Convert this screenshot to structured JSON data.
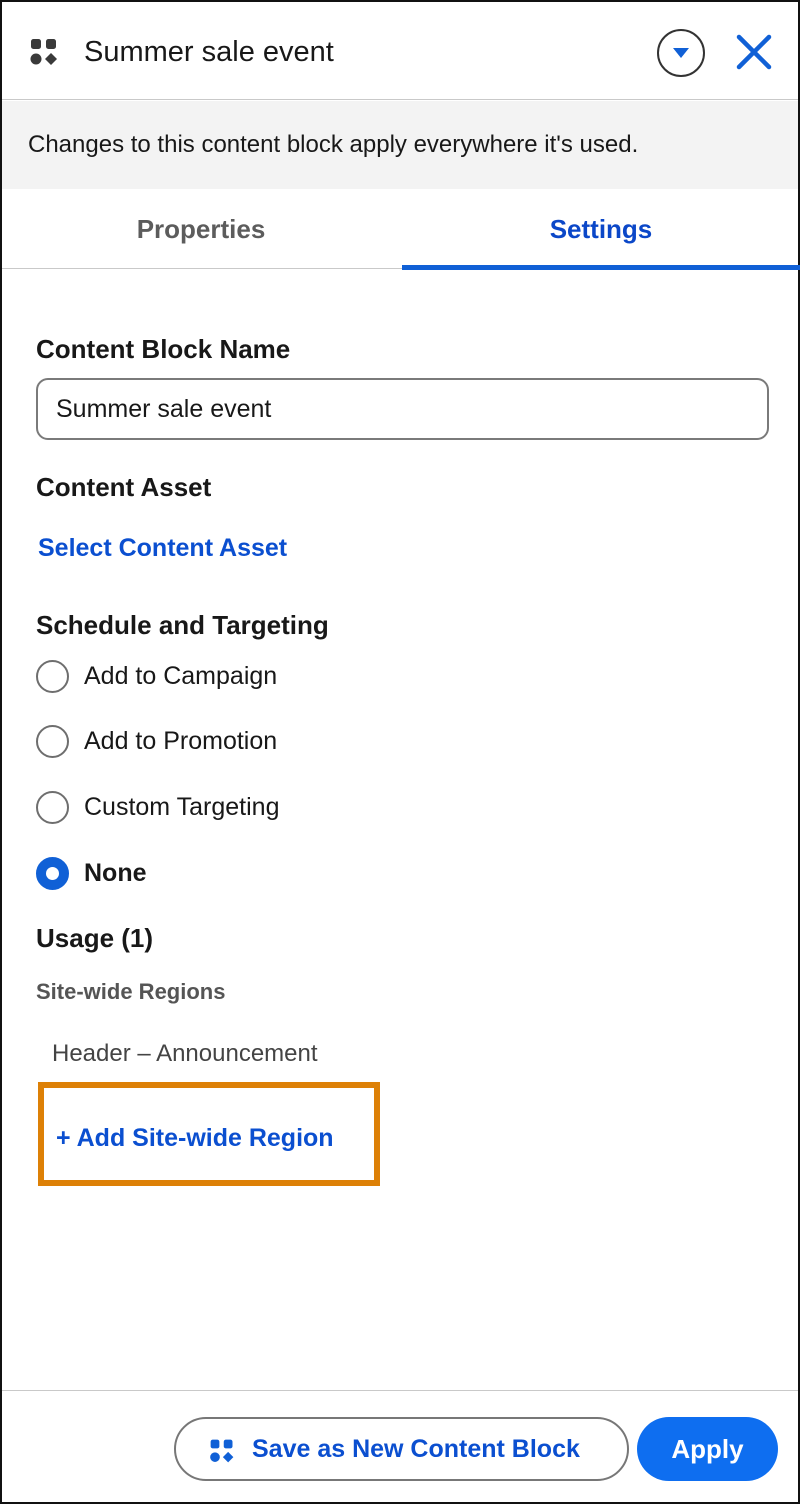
{
  "header": {
    "title": "Summer sale event",
    "icon": "content-block-icon",
    "dropdown_icon": "chevron-down-icon",
    "close_icon": "close-icon"
  },
  "banner": {
    "text": "Changes to this content block apply everywhere it's used."
  },
  "tabs": [
    {
      "label": "Properties",
      "active": false
    },
    {
      "label": "Settings",
      "active": true
    }
  ],
  "settings": {
    "name_label": "Content Block Name",
    "name_value": "Summer sale event",
    "asset_label": "Content Asset",
    "asset_link": "Select Content Asset",
    "schedule_label": "Schedule and Targeting",
    "schedule_options": [
      {
        "label": "Add to Campaign",
        "checked": false
      },
      {
        "label": "Add to Promotion",
        "checked": false
      },
      {
        "label": "Custom Targeting",
        "checked": false
      },
      {
        "label": "None",
        "checked": true
      }
    ],
    "usage_label": "Usage (1)",
    "regions_label": "Site-wide Regions",
    "regions": [
      "Header – Announcement"
    ],
    "add_region_link": "+ Add Site-wide Region"
  },
  "footer": {
    "save_new_label": "Save as New Content Block",
    "apply_label": "Apply"
  },
  "colors": {
    "accent": "#0e6ef0",
    "link": "#0b4fd0",
    "highlight": "#dd8006"
  }
}
